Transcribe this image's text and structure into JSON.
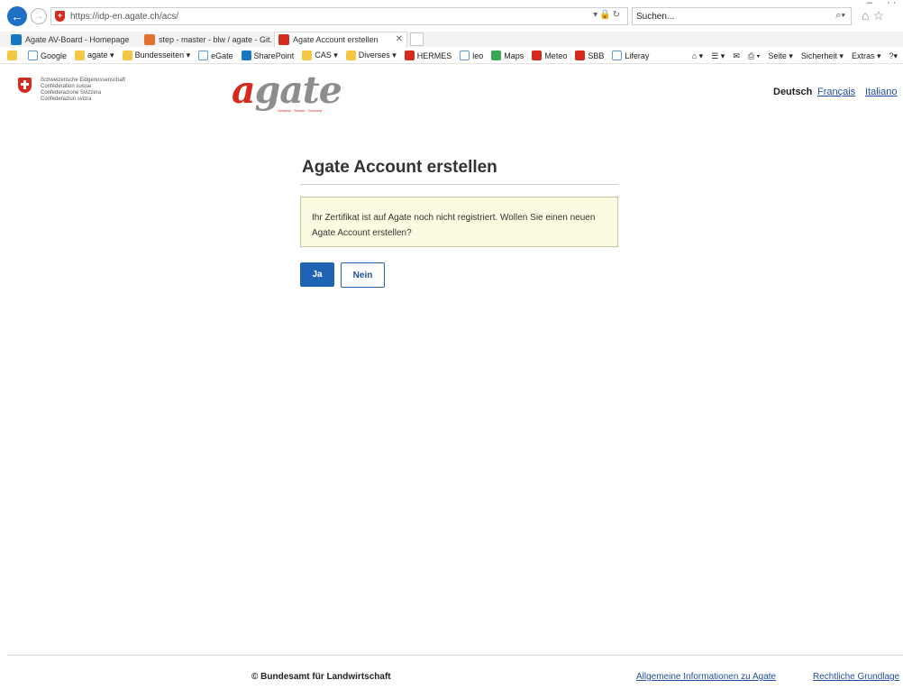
{
  "browser": {
    "url": "https://idp-en.agate.ch/acs/",
    "search_placeholder": "Suchen...",
    "tabs": [
      {
        "label": "Agate AV-Board - Homepage",
        "icon": "sharepoint-icon"
      },
      {
        "label": "step - master - blw / agate - Git...",
        "icon": "gitlab-icon"
      },
      {
        "label": "Agate Account erstellen",
        "icon": "shield-icon",
        "active": true
      }
    ],
    "favorites": [
      {
        "label": "Google",
        "icon": "ie-icon"
      },
      {
        "label": "agate ▾",
        "icon": "folder-icon"
      },
      {
        "label": "Bundesseiten ▾",
        "icon": "folder-icon"
      },
      {
        "label": "eGate",
        "icon": "ie-icon"
      },
      {
        "label": "SharePoint",
        "icon": "sharepoint-icon"
      },
      {
        "label": "CAS ▾",
        "icon": "folder-icon"
      },
      {
        "label": "Diverses ▾",
        "icon": "folder-icon"
      },
      {
        "label": "HERMES",
        "icon": "shield-icon"
      },
      {
        "label": "leo",
        "icon": "ie-icon"
      },
      {
        "label": "Maps",
        "icon": "maps-icon"
      },
      {
        "label": "Meteo",
        "icon": "srf-icon"
      },
      {
        "label": "SBB",
        "icon": "sbb-icon"
      },
      {
        "label": "Liferay",
        "icon": "ie-icon"
      }
    ],
    "command_bar": {
      "page": "Seite ▾",
      "security": "Sicherheit ▾",
      "extras": "Extras ▾"
    }
  },
  "header": {
    "confederation": [
      "Schweizerische Eidgenossenschaft",
      "Confédération suisse",
      "Confederazione Svizzera",
      "Confederaziun svizra"
    ],
    "logo_text": "agate",
    "logo_sub": "Schweiz · Suisse · Svizzera",
    "languages": {
      "de": "Deutsch",
      "fr": "Français",
      "it": "Italiano"
    }
  },
  "main": {
    "title": "Agate Account erstellen",
    "notice": "Ihr Zertifikat ist auf Agate noch nicht registriert. Wollen Sie einen neuen Agate Account erstellen?",
    "yes_label": "Ja",
    "no_label": "Nein"
  },
  "footer": {
    "copyright": "© Bundesamt für Landwirtschaft",
    "link_info": "Allgemeine Informationen zu Agate",
    "link_legal": "Rechtliche Grundlage"
  },
  "colors": {
    "brand_red": "#d52b1e",
    "primary_blue": "#1f63b5",
    "notice_bg": "#fcfbe1"
  }
}
